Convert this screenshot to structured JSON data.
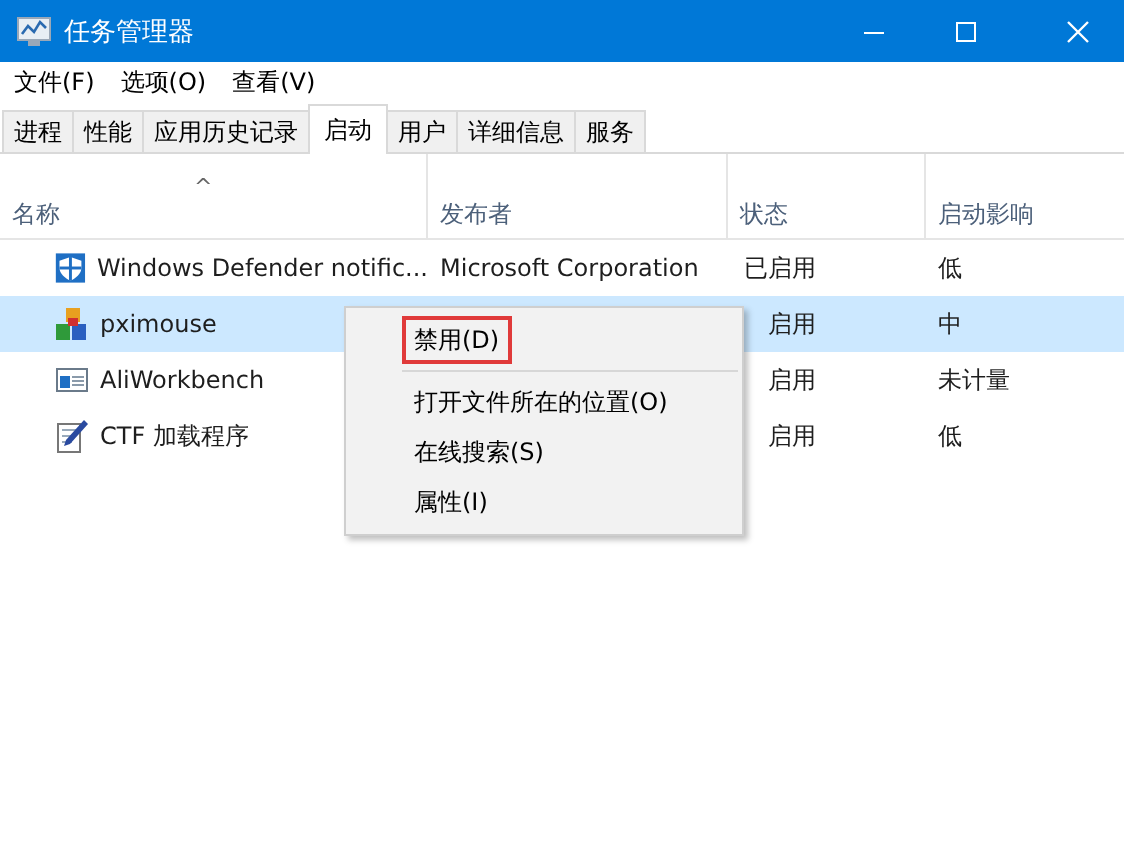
{
  "window": {
    "title": "任务管理器"
  },
  "menu_bar": [
    "文件(F)",
    "选项(O)",
    "查看(V)"
  ],
  "tabs": [
    {
      "label": "进程",
      "selected": false
    },
    {
      "label": "性能",
      "selected": false
    },
    {
      "label": "应用历史记录",
      "selected": false
    },
    {
      "label": "启动",
      "selected": true
    },
    {
      "label": "用户",
      "selected": false
    },
    {
      "label": "详细信息",
      "selected": false
    },
    {
      "label": "服务",
      "selected": false
    }
  ],
  "table": {
    "sort_indicator": "^",
    "columns": [
      "名称",
      "发布者",
      "状态",
      "启动影响"
    ],
    "rows": [
      {
        "name": "Windows Defender notific...",
        "publisher": "Microsoft Corporation",
        "status": "已启用",
        "impact": "低",
        "selected": false
      },
      {
        "name": "pximouse",
        "status": "启用",
        "impact": "中",
        "selected": true
      },
      {
        "name": "AliWorkbench",
        "status": "启用",
        "impact": "未计量",
        "selected": false
      },
      {
        "name": "CTF 加载程序",
        "status": "启用",
        "impact": "低",
        "selected": false
      }
    ]
  },
  "context_menu": {
    "items": [
      {
        "label": "禁用(D)",
        "outlined": true,
        "separator_after": true
      },
      {
        "label": "打开文件所在的位置(O)",
        "outlined": false,
        "separator_after": false
      },
      {
        "label": "在线搜索(S)",
        "outlined": false,
        "separator_after": false
      },
      {
        "label": "属性(I)",
        "outlined": false,
        "separator_after": false
      }
    ]
  }
}
